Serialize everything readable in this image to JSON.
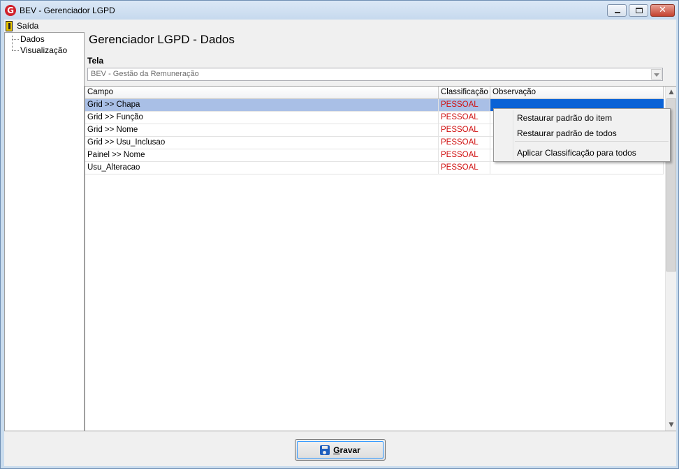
{
  "window": {
    "title": "BEV - Gerenciador LGPD",
    "app_icon": "G"
  },
  "menu": {
    "exit_label": "Saída"
  },
  "tree": {
    "items": [
      "Dados",
      "Visualização"
    ]
  },
  "page": {
    "title": "Gerenciador LGPD - Dados"
  },
  "tela": {
    "label": "Tela",
    "value": "BEV - Gestão da Remuneração"
  },
  "grid": {
    "columns": [
      "Campo",
      "Classificação",
      "Observação"
    ],
    "rows": [
      {
        "campo": "Grid >> Chapa",
        "classificacao": "PESSOAL",
        "observacao": ""
      },
      {
        "campo": "Grid >> Função",
        "classificacao": "PESSOAL",
        "observacao": ""
      },
      {
        "campo": "Grid >> Nome",
        "classificacao": "PESSOAL",
        "observacao": ""
      },
      {
        "campo": "Grid >> Usu_Inclusao",
        "classificacao": "PESSOAL",
        "observacao": ""
      },
      {
        "campo": "Painel >> Nome",
        "classificacao": "PESSOAL",
        "observacao": ""
      },
      {
        "campo": "Usu_Alteracao",
        "classificacao": "PESSOAL",
        "observacao": ""
      }
    ]
  },
  "context_menu": {
    "items": [
      "Restaurar padrão do item",
      "Restaurar padrão de todos",
      "Aplicar Classificação para todos"
    ]
  },
  "footer": {
    "save_first": "G",
    "save_rest": "ravar"
  },
  "colors": {
    "classification": "#d01010",
    "selection": "#a9bfe6",
    "selection_focus": "#0a62d6"
  }
}
